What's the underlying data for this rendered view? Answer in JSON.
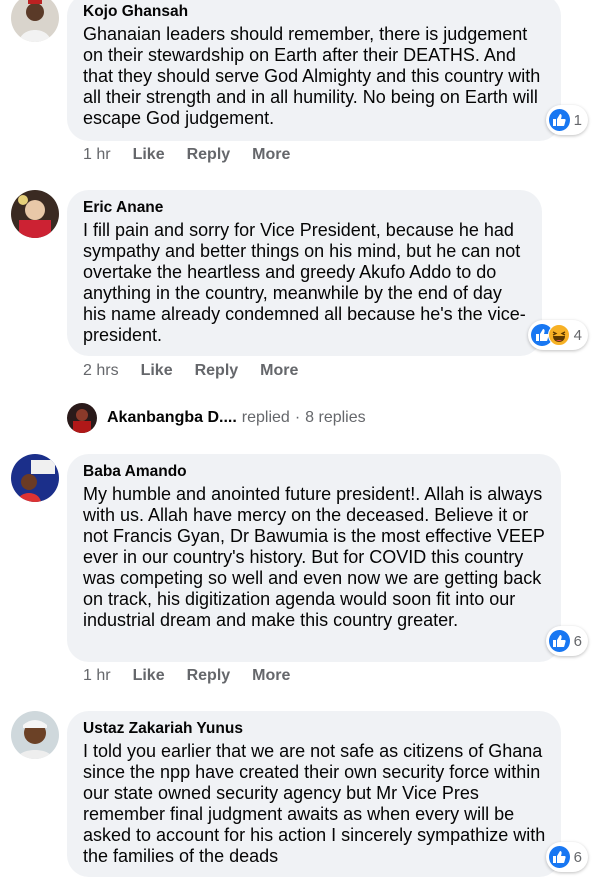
{
  "comments": [
    {
      "author": "Kojo Ghansah",
      "text": "Ghanaian leaders should remember, there is judgement on their stewardship on Earth after their DEATHS. And that they should serve God Almighty and this country with all their strength and in all humility. No being on Earth will escape God judgement.",
      "reaction_count": "1",
      "time": "1 hr",
      "like": "Like",
      "reply": "Reply",
      "more": "More"
    },
    {
      "author": "Eric Anane",
      "text": "I fill pain and sorry for Vice President, because he had sympathy and better things on his mind, but he can not overtake the heartless and greedy Akufo Addo to do anything in the country, meanwhile by the end of day his name already condemned all because he's the vice-president.",
      "reaction_count": "4",
      "time": "2 hrs",
      "like": "Like",
      "reply": "Reply",
      "more": "More"
    },
    {
      "author": "Baba Amando",
      "text": "My humble and anointed future president!. Allah is always with us. Allah have mercy on the deceased. Believe it or not Francis Gyan, Dr Bawumia is the most effective VEEP ever in our country's history. But for COVID this country was competing so well and even now we are getting back on track, his digitization agenda would soon fit into our industrial dream and make this country greater.",
      "reaction_count": "6",
      "time": "1 hr",
      "like": "Like",
      "reply": "Reply",
      "more": "More"
    },
    {
      "author": "Ustaz Zakariah Yunus",
      "text": "I told you earlier that we are not safe as citizens of Ghana since the npp have created their own security force within our state owned security agency but Mr Vice Pres remember final judgment awaits as when every will be asked to account for his action I sincerely sympathize with the families of the deads",
      "reaction_count": "6"
    }
  ],
  "reply_summary": {
    "name": "Akanbangba D....",
    "action": "replied",
    "separator": "·",
    "count": "8 replies"
  },
  "colors": {
    "bubble": "#f0f2f5",
    "like_blue": "#1877f2",
    "meta_gray": "#65676b"
  },
  "icons": [
    "like-icon",
    "haha-icon",
    "avatar"
  ]
}
